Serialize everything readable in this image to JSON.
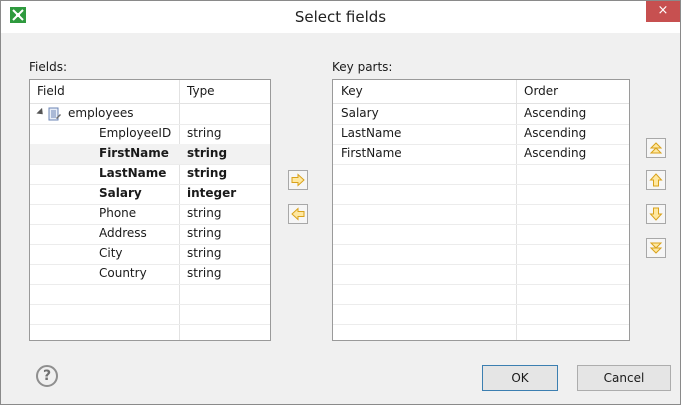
{
  "window": {
    "title": "Select fields",
    "close_label": "×"
  },
  "fields_panel": {
    "label": "Fields:",
    "columns": [
      "Field",
      "Type"
    ],
    "root": "employees",
    "rows": [
      {
        "field": "EmployeeID",
        "type": "string",
        "bold": false
      },
      {
        "field": "FirstName",
        "type": "string",
        "bold": true
      },
      {
        "field": "LastName",
        "type": "string",
        "bold": true
      },
      {
        "field": "Salary",
        "type": "integer",
        "bold": true
      },
      {
        "field": "Phone",
        "type": "string",
        "bold": false
      },
      {
        "field": "Address",
        "type": "string",
        "bold": false
      },
      {
        "field": "City",
        "type": "string",
        "bold": false
      },
      {
        "field": "Country",
        "type": "string",
        "bold": false
      }
    ]
  },
  "key_panel": {
    "label": "Key parts:",
    "columns": [
      "Key",
      "Order"
    ],
    "rows": [
      {
        "key": "Salary",
        "order": "Ascending"
      },
      {
        "key": "LastName",
        "order": "Ascending"
      },
      {
        "key": "FirstName",
        "order": "Ascending"
      }
    ]
  },
  "buttons": {
    "ok": "OK",
    "cancel": "Cancel",
    "help": "?"
  },
  "colors": {
    "arrow_fill": "#ffe8a0",
    "arrow_stroke": "#d9a21b",
    "app_icon": "#2f9a3e",
    "close": "#c75050"
  }
}
